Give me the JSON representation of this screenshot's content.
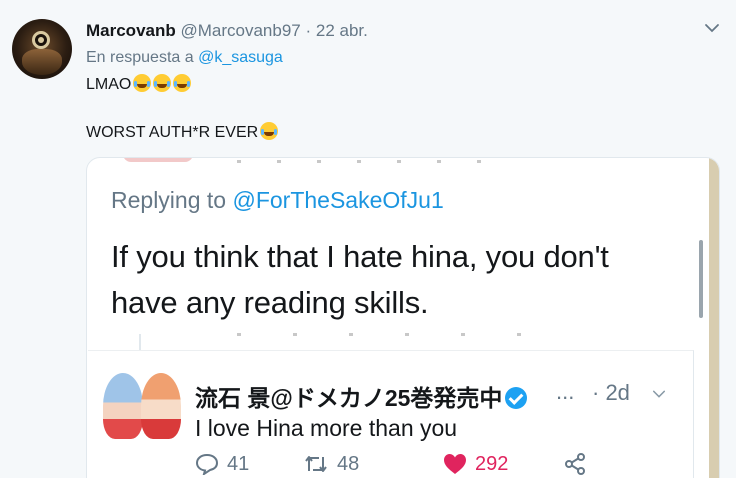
{
  "tweet": {
    "display_name": "Marcovanb",
    "handle": "@Marcovanb97",
    "separator": " · ",
    "date": "22 abr.",
    "reply_prefix": "En respuesta a",
    "reply_handle": "@k_sasuga",
    "line1": "LMAO",
    "line2": "WORST AUTH*R EVER"
  },
  "embedded": {
    "replying_prefix": "Replying to",
    "replying_handle": "@ForTheSakeOfJu1",
    "text_line1": "If you think that I hate hina, you don't",
    "text_line2": "have any reading skills.",
    "quoted": {
      "name": "流石 景@ドメカノ25巻発売中",
      "ellipsis": "...",
      "date": "· 2d",
      "text": "I love Hina more than you",
      "replies": "41",
      "retweets": "48",
      "likes": "292"
    }
  },
  "icons": [
    "chevron-down-icon",
    "verified-badge-icon",
    "reply-icon",
    "retweet-icon",
    "heart-icon",
    "share-icon",
    "laughing-emoji"
  ],
  "colors": {
    "link": "#1b95e0",
    "muted": "#657786",
    "like": "#e0245e",
    "verified": "#1da1f2"
  }
}
